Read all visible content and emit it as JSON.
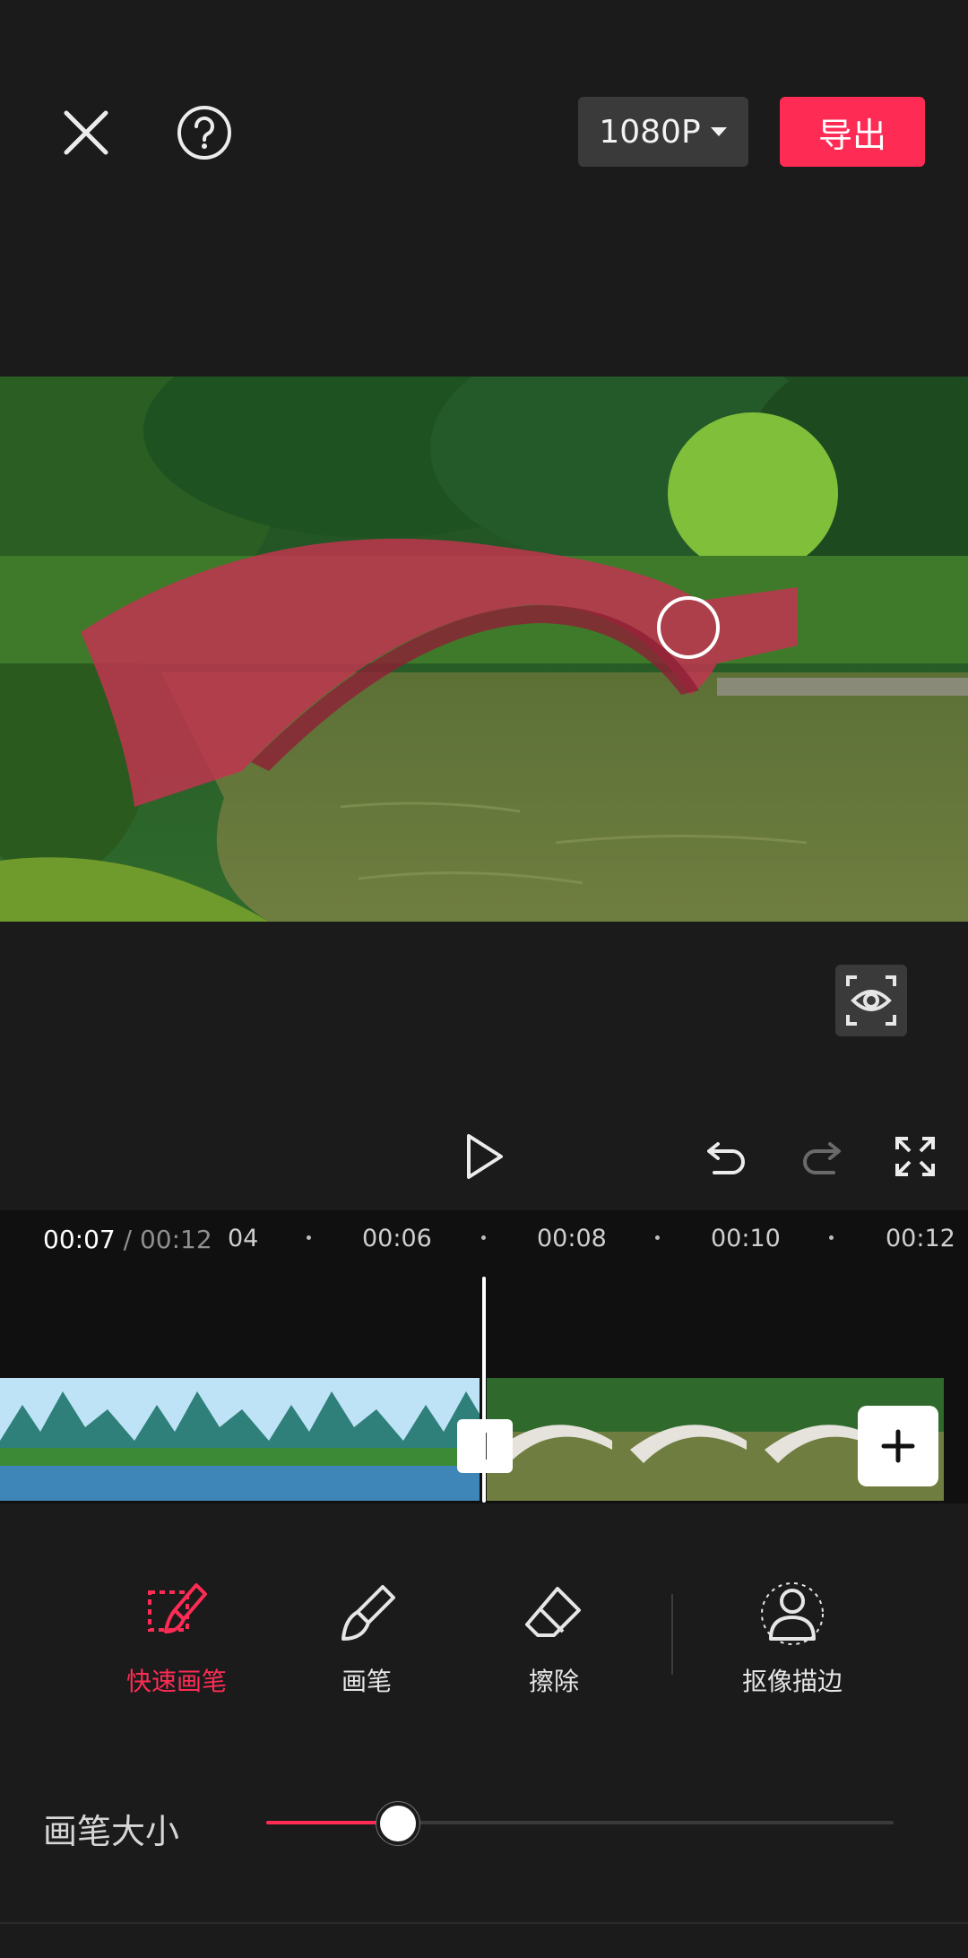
{
  "topbar": {
    "resolution": "1080P",
    "export_label": "导出"
  },
  "timeline": {
    "current_time": "00:07",
    "separator": " / ",
    "total_time": "00:12",
    "ticks": [
      {
        "label": "04"
      },
      {
        "label": "00:06"
      },
      {
        "label": "00:08"
      },
      {
        "label": "00:10"
      },
      {
        "label": "00:12"
      }
    ]
  },
  "tools": [
    {
      "label": "快速画笔",
      "icon": "quick-brush-icon",
      "active": true
    },
    {
      "label": "画笔",
      "icon": "brush-icon",
      "active": false
    },
    {
      "label": "擦除",
      "icon": "eraser-icon",
      "active": false
    },
    {
      "label": "抠像描边",
      "icon": "cutout-stroke-icon",
      "active": false
    }
  ],
  "brush_size": {
    "label": "画笔大小",
    "value": 0.21
  },
  "colors": {
    "accent": "#fe2c55",
    "background": "#1b1b1b",
    "mask": "#c0354f"
  }
}
